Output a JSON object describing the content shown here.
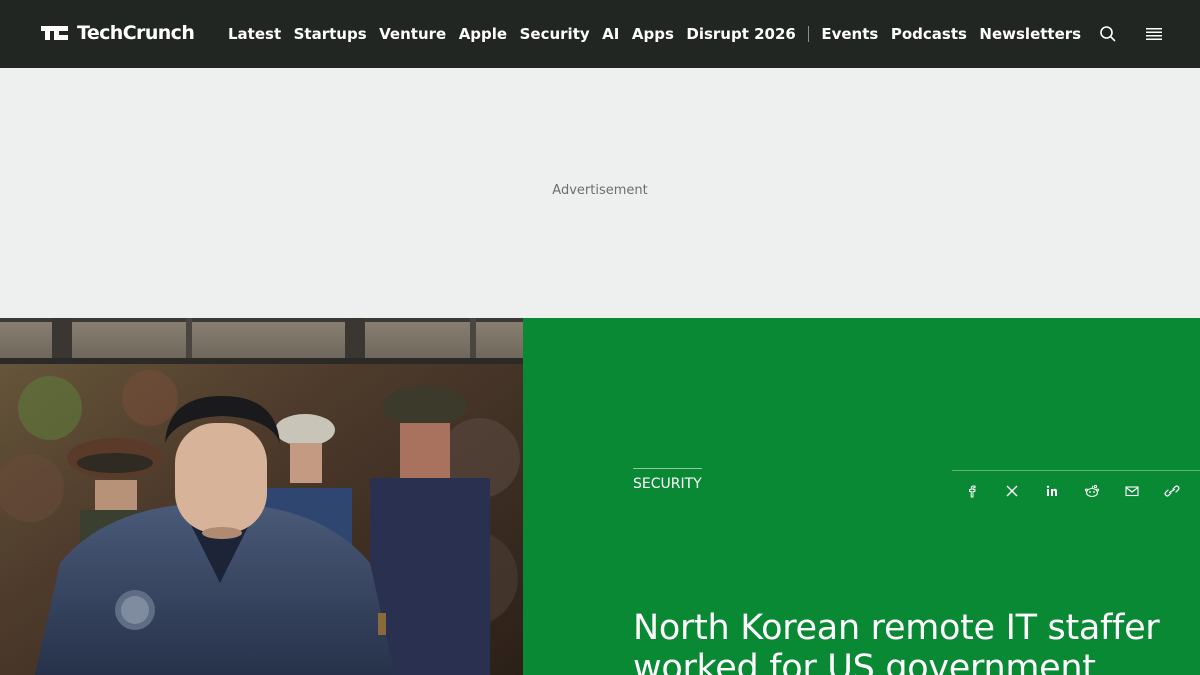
{
  "header": {
    "logo_text": "TechCrunch",
    "nav": [
      "Latest",
      "Startups",
      "Venture",
      "Apple",
      "Security",
      "AI",
      "Apps",
      "Disrupt 2026"
    ],
    "nav_secondary": [
      "Events",
      "Podcasts",
      "Newsletters"
    ]
  },
  "ad": {
    "label": "Advertisement"
  },
  "article": {
    "category": "SECURITY",
    "headline": "North Korean remote IT staffer worked for US government",
    "share_icons": [
      "facebook-icon",
      "x-icon",
      "linkedin-icon",
      "reddit-icon",
      "email-icon",
      "link-icon"
    ]
  },
  "colors": {
    "nav_bg": "#222623",
    "ad_bg": "#edf0ef",
    "accent_green": "#0a8935"
  }
}
